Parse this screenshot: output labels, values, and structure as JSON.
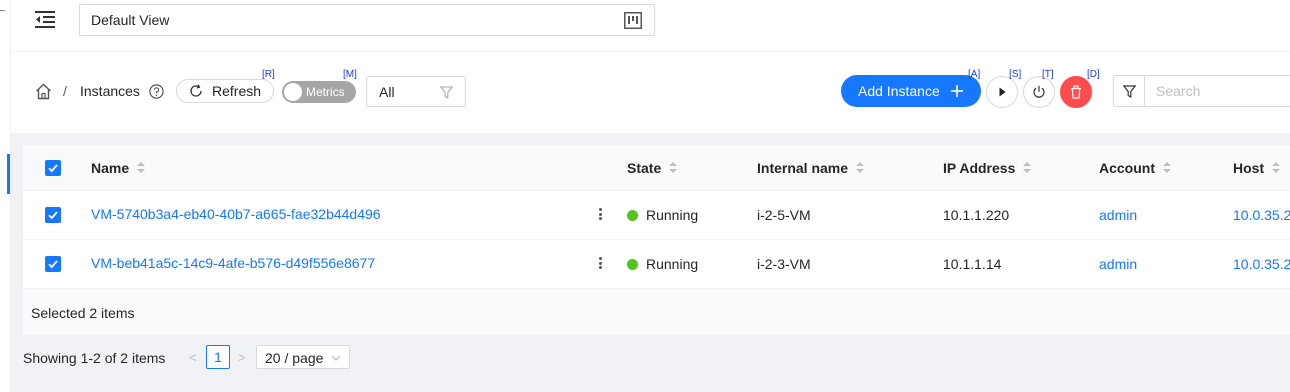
{
  "header": {
    "view_selector": {
      "value": "Default View"
    }
  },
  "toolbar": {
    "breadcrumb_separator": "/",
    "breadcrumb_label": "Instances",
    "refresh_label": "Refresh",
    "refresh_shortcut": "[R]",
    "metrics_label": "Metrics",
    "metrics_shortcut": "[M]",
    "metrics_enabled": false,
    "filter_value": "All",
    "add_instance_label": "Add Instance",
    "add_shortcut": "[A]",
    "start_shortcut": "[S]",
    "stop_shortcut": "[T]",
    "delete_shortcut": "[D]",
    "delete_color": "#ff4d4f",
    "search_placeholder": "Search"
  },
  "table": {
    "columns": [
      "Name",
      "State",
      "Internal name",
      "IP Address",
      "Account",
      "Host"
    ],
    "rows": [
      {
        "name": "VM-5740b3a4-eb40-40b7-a665-fae32b44d496",
        "state": "Running",
        "internal_name": "i-2-5-VM",
        "ip_address": "10.1.1.220",
        "account": "admin",
        "host": "10.0.35.2",
        "selected": true
      },
      {
        "name": "VM-beb41a5c-14c9-4afe-b576-d49f556e8677",
        "state": "Running",
        "internal_name": "i-2-3-VM",
        "ip_address": "10.1.1.14",
        "account": "admin",
        "host": "10.0.35.2",
        "selected": true
      }
    ],
    "selected_text": "Selected 2 items",
    "state_color": "#52c41a"
  },
  "pagination": {
    "total_text": "Showing 1-2 of 2 items",
    "prev": "<",
    "current_page": "1",
    "next": ">",
    "page_size": "20 / page"
  },
  "colors": {
    "primary": "#1677ff",
    "danger": "#ff4d4f",
    "running": "#52c41a"
  }
}
